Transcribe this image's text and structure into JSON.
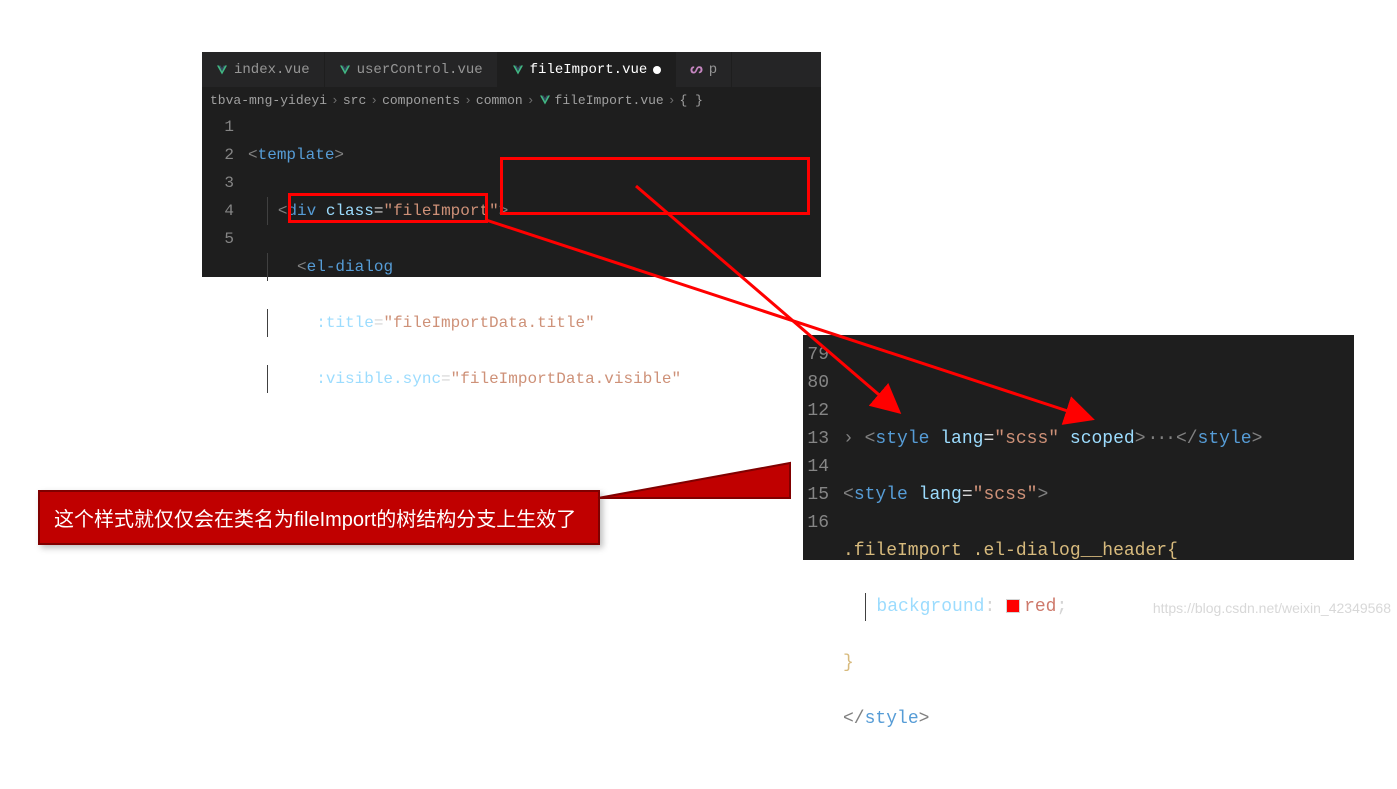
{
  "tabs": [
    {
      "label": "index.vue",
      "active": false
    },
    {
      "label": "userControl.vue",
      "active": false
    },
    {
      "label": "fileImport.vue",
      "active": true,
      "dirty": true
    },
    {
      "label": "p",
      "active": false,
      "icon": "branch"
    }
  ],
  "breadcrumb": {
    "p0": "tbva-mng-yideyi",
    "p1": "src",
    "p2": "components",
    "p3": "common",
    "p4": "fileImport.vue",
    "p5": "{ }"
  },
  "top_gutter": [
    "1",
    "2",
    "3",
    "4",
    "5"
  ],
  "top_code": {
    "l1": {
      "lt": "<",
      "tag": "template",
      "gt": ">"
    },
    "l2": {
      "lt": "<",
      "tag": "div",
      "sp": " ",
      "attr": "class",
      "eq": "=",
      "val": "\"fileImport\"",
      "gt": ">"
    },
    "l3": {
      "lt": "<",
      "tag": "el-dialog"
    },
    "l4": {
      "attr": ":title",
      "eq": "=",
      "val": "\"fileImportData.title\""
    },
    "l5": {
      "attr": ":visible.sync",
      "eq": "=",
      "val": "\"fileImportData.visible\""
    }
  },
  "bot_gutter": [
    "79",
    "80",
    "12",
    "13",
    "14",
    "15",
    "16"
  ],
  "bot_code": {
    "l80": {
      "lt1": "<",
      "tag1": "style",
      "a1": "lang",
      "v1": "\"scss\"",
      "a2": "scoped",
      "gt1": ">",
      "fold": "···",
      "lt2": "</",
      "tag2": "style",
      "gt2": ">"
    },
    "l12": {
      "lt": "<",
      "tag": "style",
      "a1": "lang",
      "eq": "=",
      "v1": "\"scss\"",
      "gt": ">"
    },
    "l13": {
      "s1": ".fileImport",
      "sp": " ",
      "s2": ".el-dialog__header",
      "br": "{"
    },
    "l14": {
      "prop": "background",
      "colon": ": ",
      "val": "red",
      "semi": ";"
    },
    "l15": {
      "br": "}"
    },
    "l16": {
      "lt": "</",
      "tag": "style",
      "gt": ">"
    }
  },
  "annotation": "这个样式就仅仅会在类名为fileImport的树结构分支上生效了",
  "watermark": "https://blog.csdn.net/weixin_42349568"
}
